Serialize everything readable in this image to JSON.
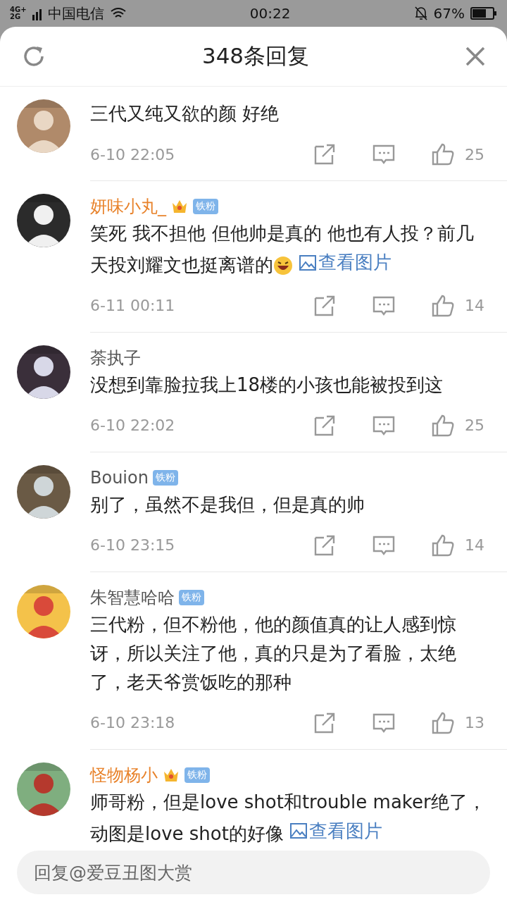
{
  "status_bar": {
    "networks": [
      "4G+",
      "2G"
    ],
    "carrier": "中国电信",
    "time": "00:22",
    "battery": "67%"
  },
  "header": {
    "title": "348条回复"
  },
  "comments": [
    {
      "text": "三代又纯又欲的颜 好绝",
      "time": "6-10 22:05",
      "likes": "25"
    },
    {
      "name": "妍味小丸_",
      "vip": true,
      "fan_badge": "铁粉",
      "text": "笑死 我不担他 但他帅是真的 他也有人投？前几天投刘耀文也挺离谱的",
      "emoji": true,
      "image_link": "查看图片",
      "time": "6-11 00:11",
      "likes": "14"
    },
    {
      "name": "荼执子",
      "vip": false,
      "text": "没想到靠脸拉我上18楼的小孩也能被投到这",
      "time": "6-10 22:02",
      "likes": "25"
    },
    {
      "name": "Bouion",
      "vip": false,
      "fan_badge": "铁粉",
      "text": "别了，虽然不是我但，但是真的帅",
      "time": "6-10 23:15",
      "likes": "14"
    },
    {
      "name": "朱智慧哈哈",
      "vip": false,
      "fan_badge": "铁粉",
      "text": "三代粉，但不粉他，他的颜值真的让人感到惊讶，所以关注了他，真的只是为了看脸，太绝了，老天爷赏饭吃的那种",
      "time": "6-10 23:18",
      "likes": "13"
    },
    {
      "name": "怪物杨小",
      "vip": true,
      "fan_badge": "铁粉",
      "text": "师哥粉，但是love shot和trouble maker绝了，动图是love shot的好像",
      "image_link": "查看图片"
    }
  ],
  "reply_field": {
    "placeholder": "回复@爱豆丑图大赏"
  }
}
